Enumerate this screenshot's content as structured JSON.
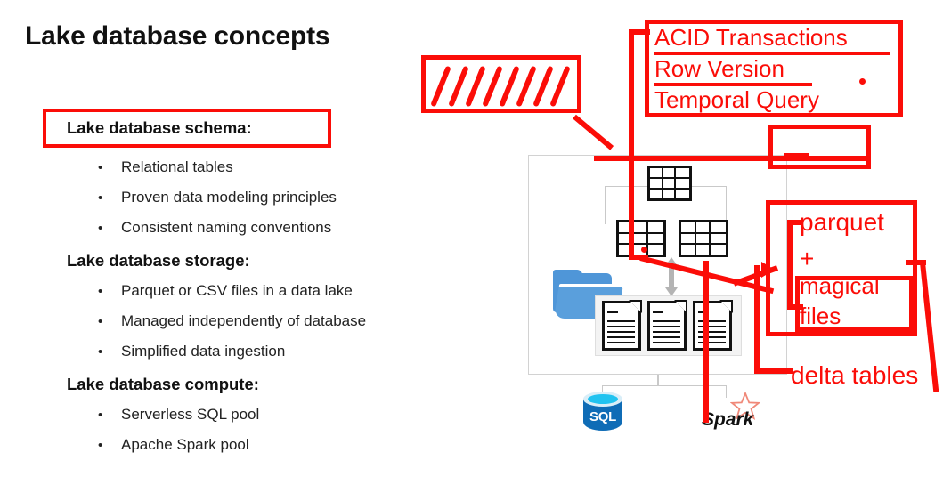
{
  "slide": {
    "title": "Lake database concepts",
    "accent_red": "#fb0d08",
    "sections": [
      {
        "heading": "Lake database schema:",
        "highlighted": true,
        "bullets": [
          "Relational tables",
          "Proven data modeling principles",
          "Consistent naming conventions"
        ]
      },
      {
        "heading": "Lake database storage:",
        "highlighted": false,
        "bullets": [
          "Parquet or CSV files in a data lake",
          "Managed independently of database",
          "Simplified data ingestion"
        ]
      },
      {
        "heading": "Lake database compute:",
        "highlighted": false,
        "bullets": [
          "Serverless SQL pool",
          "Apache Spark pool"
        ]
      }
    ],
    "bullet_glyph": "•"
  },
  "diagram": {
    "sql_label": "SQL",
    "spark_label": "Spark",
    "table_icon_count": 3,
    "document_icon_count": 3,
    "folder_icon": "open-folder-icon"
  },
  "annotations": {
    "acid_box": {
      "lines": [
        "ACID Transactions",
        "Row Version",
        "Temporal Query"
      ],
      "underlined": [
        true,
        true,
        false
      ]
    },
    "hatched_box": {
      "label": "scribble-hatch-marks",
      "stroke_count": 8
    },
    "empty_box": {
      "label": "empty-red-callout-box"
    },
    "parquet_box": {
      "line1": "parquet",
      "line2": "+",
      "line3": "magical",
      "line4": "files"
    },
    "delta_label": "delta tables"
  }
}
